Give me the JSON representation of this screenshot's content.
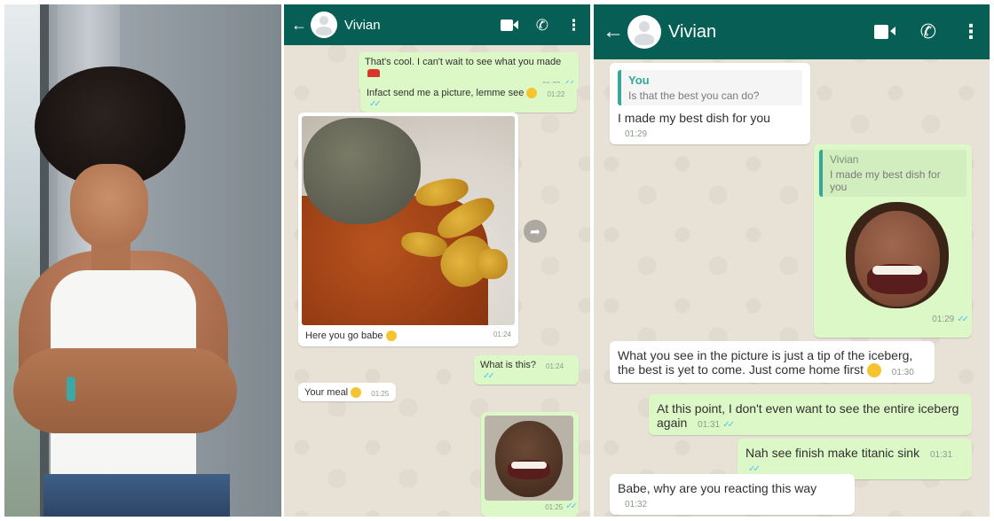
{
  "chat1": {
    "contact": "Vivian",
    "icons": [
      "back-arrow-icon",
      "avatar",
      "video-call-icon",
      "voice-call-icon",
      "more-options-icon"
    ],
    "messages": [
      {
        "dir": "out",
        "text": "That's cool. I can't wait to see what you made",
        "time": "01:22"
      },
      {
        "dir": "out",
        "text": "Infact send me a picture, lemme see",
        "time": "01:22"
      },
      {
        "dir": "in",
        "caption": "Here you go babe",
        "time": "01:24"
      },
      {
        "dir": "out",
        "text": "What is this?",
        "time": "01:24"
      },
      {
        "dir": "in",
        "text": "Your meal",
        "time": "01:25"
      },
      {
        "dir": "out",
        "time": "01:25"
      }
    ]
  },
  "chat2": {
    "contact": "Vivian",
    "icons": [
      "back-arrow-icon",
      "avatar",
      "video-call-icon",
      "voice-call-icon",
      "more-options-icon"
    ],
    "messages": [
      {
        "dir": "in",
        "quote_name": "You",
        "quote_text": "Is that the best you can do?",
        "text": "I made my best dish for you",
        "time": "01:29"
      },
      {
        "dir": "out",
        "quote_name": "Vivian",
        "quote_text": "I made my best dish for you",
        "time": "01:29"
      },
      {
        "dir": "in",
        "text": "What you see in the picture is just a tip of the iceberg, the best is yet to come. Just come home first",
        "time": "01:30"
      },
      {
        "dir": "out",
        "text": "At this point, I don't even want to see the entire iceberg again",
        "time": "01:31"
      },
      {
        "dir": "out",
        "text": "Nah see finish make titanic sink",
        "time": "01:31"
      },
      {
        "dir": "in",
        "text": "Babe, why are you reacting this way",
        "time": "01:32"
      }
    ]
  },
  "colors": {
    "header": "#075e54",
    "outgoing": "#dcf8c6",
    "incoming": "#ffffff",
    "read_ticks": "#4fc3f7"
  }
}
